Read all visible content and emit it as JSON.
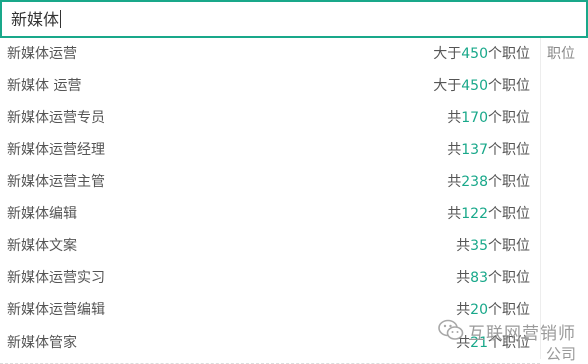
{
  "search": {
    "value": "新媒体"
  },
  "side_tab": {
    "label": "职位"
  },
  "suggestions": [
    {
      "keyword": "新媒体运营",
      "prefix": "大于",
      "count": "450",
      "suffix": "个职位"
    },
    {
      "keyword": "新媒体 运营",
      "prefix": "大于",
      "count": "450",
      "suffix": "个职位"
    },
    {
      "keyword": "新媒体运营专员",
      "prefix": "共",
      "count": "170",
      "suffix": "个职位"
    },
    {
      "keyword": "新媒体运营经理",
      "prefix": "共",
      "count": "137",
      "suffix": "个职位"
    },
    {
      "keyword": "新媒体运营主管",
      "prefix": "共",
      "count": "238",
      "suffix": "个职位"
    },
    {
      "keyword": "新媒体编辑",
      "prefix": "共",
      "count": "122",
      "suffix": "个职位"
    },
    {
      "keyword": "新媒体文案",
      "prefix": "共",
      "count": "35",
      "suffix": "个职位"
    },
    {
      "keyword": "新媒体运营实习",
      "prefix": "共",
      "count": "83",
      "suffix": "个职位"
    },
    {
      "keyword": "新媒体运营编辑",
      "prefix": "共",
      "count": "20",
      "suffix": "个职位"
    },
    {
      "keyword": "新媒体管家",
      "prefix": "共",
      "count": "21",
      "suffix": "个职位"
    }
  ],
  "watermark": {
    "name": "互联网营销师",
    "tail": "公司",
    "icon": "wechat-icon"
  },
  "colors": {
    "accent": "#19a88a",
    "text": "#555555"
  }
}
